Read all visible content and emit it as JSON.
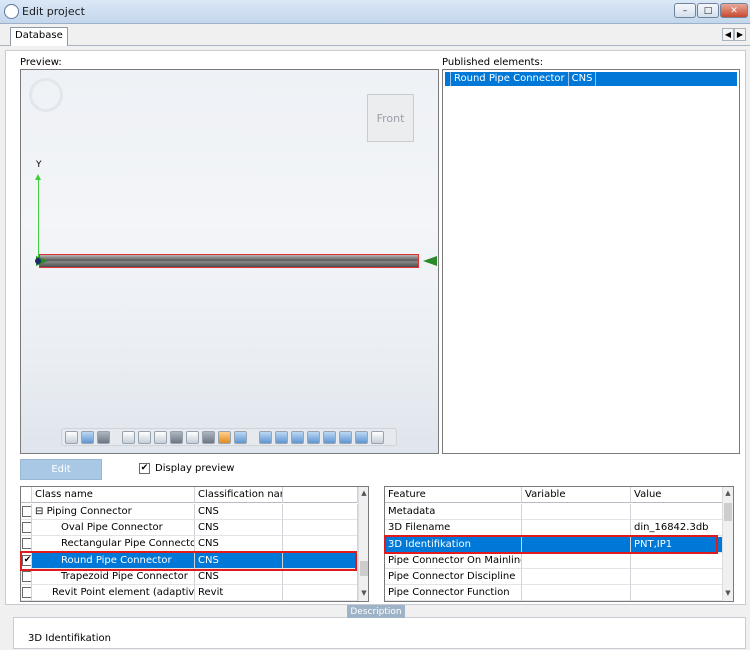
{
  "window": {
    "title": "Edit project",
    "min_glyph": "–",
    "max_glyph": "□",
    "close_glyph": "✕"
  },
  "tabs": {
    "active": "Database",
    "prev_glyph": "◀",
    "next_glyph": "▶"
  },
  "preview": {
    "label": "Preview:",
    "view_cube_label": "Front",
    "y_axis_label": "Y"
  },
  "published": {
    "label": "Published elements:",
    "rows": [
      {
        "name": "Round Pipe Connector",
        "classification": "CNS"
      }
    ]
  },
  "actions": {
    "edit_label": "Edit",
    "display_preview_label": "Display preview",
    "display_preview_checked": "✔"
  },
  "classes": {
    "headers": [
      "Class name",
      "Classification name",
      ""
    ],
    "group_toggle": "⊟",
    "rows": [
      {
        "name": "Piping Connector",
        "classification": "CNS",
        "checked": ""
      },
      {
        "name": "Oval Pipe Connector",
        "classification": "CNS",
        "checked": ""
      },
      {
        "name": "Rectangular Pipe Connector",
        "classification": "CNS",
        "checked": ""
      },
      {
        "name": "Round Pipe Connector",
        "classification": "CNS",
        "checked": "✔"
      },
      {
        "name": "Trapezoid Pipe Connector",
        "classification": "CNS",
        "checked": ""
      },
      {
        "name": "Revit Point element (adaptive model)",
        "classification": "Revit",
        "checked": ""
      }
    ]
  },
  "features": {
    "headers": [
      "Feature",
      "Variable",
      "Value"
    ],
    "rows": [
      {
        "feature": "Metadata",
        "variable": "",
        "value": ""
      },
      {
        "feature": "3D Filename",
        "variable": "",
        "value": "din_16842.3db"
      },
      {
        "feature": "3D Identifikation",
        "variable": "",
        "value": "PNT,IP1"
      },
      {
        "feature": "Pipe Connector On Mainline",
        "variable": "",
        "value": ""
      },
      {
        "feature": "Pipe Connector Discipline",
        "variable": "",
        "value": ""
      },
      {
        "feature": "Pipe Connector Function",
        "variable": "",
        "value": ""
      }
    ]
  },
  "scroll": {
    "up_glyph": "▲",
    "down_glyph": "▼"
  },
  "description": {
    "tab_label": "Description",
    "text": "3D Identifikation"
  },
  "colors": {
    "selection": "#0078d7",
    "highlight": "#e01b1b",
    "axis_y": "#3fcf3f",
    "connector": "#2a8a2a"
  }
}
